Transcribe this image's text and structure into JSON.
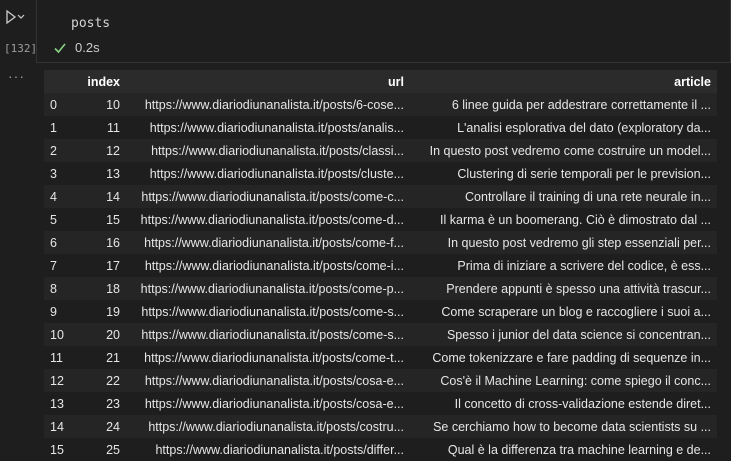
{
  "cell": {
    "exec_count": "[132]",
    "code": "posts",
    "exec_time": "0.2s",
    "more_menu": "···"
  },
  "table": {
    "columns": [
      "",
      "index",
      "url",
      "article"
    ],
    "rows": [
      [
        "0",
        "10",
        "https://www.diariodiunanalista.it/posts/6-cose...",
        "6 linee guida per addestrare correttamente il ..."
      ],
      [
        "1",
        "11",
        "https://www.diariodiunanalista.it/posts/analis...",
        "L'analisi esplorativa del dato (exploratory da..."
      ],
      [
        "2",
        "12",
        "https://www.diariodiunanalista.it/posts/classi...",
        "In questo post vedremo come costruire un model..."
      ],
      [
        "3",
        "13",
        "https://www.diariodiunanalista.it/posts/cluste...",
        "Clustering di serie temporali per le prevision..."
      ],
      [
        "4",
        "14",
        "https://www.diariodiunanalista.it/posts/come-c...",
        "Controllare il training di una rete neurale in..."
      ],
      [
        "5",
        "15",
        "https://www.diariodiunanalista.it/posts/come-d...",
        "Il karma è un boomerang. Ciò è dimostrato dal ..."
      ],
      [
        "6",
        "16",
        "https://www.diariodiunanalista.it/posts/come-f...",
        "In questo post vedremo gli step essenziali per..."
      ],
      [
        "7",
        "17",
        "https://www.diariodiunanalista.it/posts/come-i...",
        "Prima di iniziare a scrivere del codice, è ess..."
      ],
      [
        "8",
        "18",
        "https://www.diariodiunanalista.it/posts/come-p...",
        "Prendere appunti è spesso una attività trascur..."
      ],
      [
        "9",
        "19",
        "https://www.diariodiunanalista.it/posts/come-s...",
        "Come scraperare un blog e raccogliere i suoi a..."
      ],
      [
        "10",
        "20",
        "https://www.diariodiunanalista.it/posts/come-s...",
        "Spesso i junior del data science si concentran..."
      ],
      [
        "11",
        "21",
        "https://www.diariodiunanalista.it/posts/come-t...",
        "Come tokenizzare e fare padding di sequenze in..."
      ],
      [
        "12",
        "22",
        "https://www.diariodiunanalista.it/posts/cosa-e...",
        "Cos'è il Machine Learning: come spiego il conc..."
      ],
      [
        "13",
        "23",
        "https://www.diariodiunanalista.it/posts/cosa-e...",
        "Il concetto di cross-validazione estende diret..."
      ],
      [
        "14",
        "24",
        "https://www.diariodiunanalista.it/posts/costru...",
        "Se cerchiamo how to become data scientists su ..."
      ],
      [
        "15",
        "25",
        "https://www.diariodiunanalista.it/posts/differ...",
        "Qual è la differenza tra machine learning e de..."
      ]
    ]
  },
  "colors": {
    "success": "#89d185",
    "background": "#1e1e1e"
  },
  "icons": {
    "run": "play-icon",
    "expand": "chevron-down-icon",
    "status": "check-icon"
  }
}
